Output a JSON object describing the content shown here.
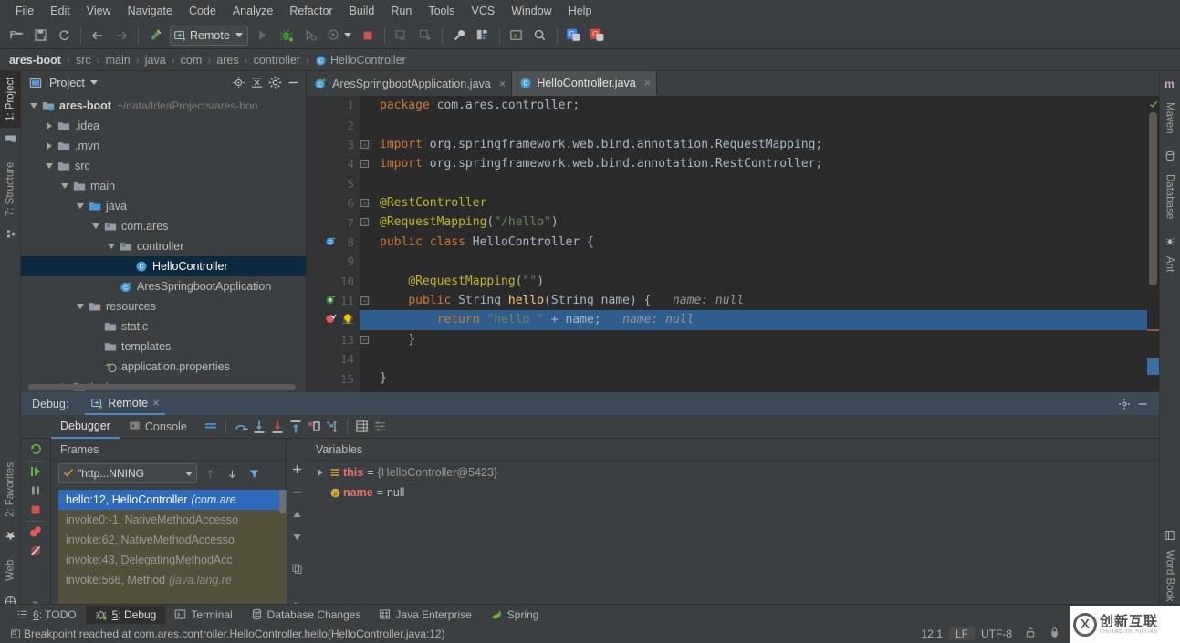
{
  "menubar": {
    "items": [
      {
        "label": "File",
        "mnemonic": "F"
      },
      {
        "label": "Edit",
        "mnemonic": "E"
      },
      {
        "label": "View",
        "mnemonic": "V"
      },
      {
        "label": "Navigate",
        "mnemonic": "N"
      },
      {
        "label": "Code",
        "mnemonic": "C"
      },
      {
        "label": "Analyze",
        "mnemonic": "A"
      },
      {
        "label": "Refactor",
        "mnemonic": "R"
      },
      {
        "label": "Build",
        "mnemonic": "B"
      },
      {
        "label": "Run",
        "mnemonic": "R"
      },
      {
        "label": "Tools",
        "mnemonic": "T"
      },
      {
        "label": "VCS",
        "mnemonic": "V"
      },
      {
        "label": "Window",
        "mnemonic": "W"
      },
      {
        "label": "Help",
        "mnemonic": "H"
      }
    ]
  },
  "toolbar": {
    "run_configuration": "Remote",
    "icons": [
      "open-folder-icon",
      "save-all-icon",
      "sync-icon",
      "back-arrow-icon",
      "forward-arrow-icon",
      "build-hammer-icon",
      "run-icon",
      "debug-icon",
      "debug-attach-icon",
      "coverage-icon",
      "stop-icon",
      "build-project-icon",
      "update-project-icon",
      "settings-wrench-icon",
      "project-structure-icon",
      "terminal-icon",
      "search-everywhere-icon",
      "translate-icon",
      "translate2-icon"
    ]
  },
  "breadcrumb": {
    "items": [
      "ares-boot",
      "src",
      "main",
      "java",
      "com",
      "ares",
      "controller",
      "HelloController"
    ],
    "separator": "›",
    "class_icon": "class-icon"
  },
  "left_stripe": {
    "items": [
      {
        "label": "1: Project",
        "mnemonic": "1",
        "selected": true
      },
      {
        "label": "7: Structure",
        "mnemonic": "7",
        "selected": false
      },
      {
        "label": "2: Favorites",
        "mnemonic": "2",
        "selected": false
      },
      {
        "label": "Web",
        "mnemonic": "",
        "selected": false
      }
    ]
  },
  "right_stripe": {
    "items": [
      {
        "label": "Maven"
      },
      {
        "label": "Database"
      },
      {
        "label": "Ant"
      },
      {
        "label": "Word Book"
      }
    ]
  },
  "project_panel": {
    "title": "Project",
    "header_icons": [
      "locate-icon",
      "collapse-all-icon",
      "gear-icon",
      "minimize-icon"
    ],
    "tree": [
      {
        "depth": 0,
        "twisty": "down",
        "icon": "module-icon",
        "label": "ares-boot",
        "sub": "~/data/IdeaProjects/ares-boo",
        "bold": true,
        "selected": false
      },
      {
        "depth": 1,
        "twisty": "right",
        "icon": "folder-icon",
        "label": ".idea",
        "sub": "",
        "bold": false,
        "selected": false
      },
      {
        "depth": 1,
        "twisty": "right",
        "icon": "folder-icon",
        "label": ".mvn",
        "sub": "",
        "bold": false,
        "selected": false
      },
      {
        "depth": 1,
        "twisty": "down",
        "icon": "folder-icon",
        "label": "src",
        "sub": "",
        "bold": false,
        "selected": false
      },
      {
        "depth": 2,
        "twisty": "down",
        "icon": "folder-icon",
        "label": "main",
        "sub": "",
        "bold": false,
        "selected": false
      },
      {
        "depth": 3,
        "twisty": "down",
        "icon": "source-folder-icon",
        "label": "java",
        "sub": "",
        "bold": false,
        "selected": false
      },
      {
        "depth": 4,
        "twisty": "down",
        "icon": "package-icon",
        "label": "com.ares",
        "sub": "",
        "bold": false,
        "selected": false
      },
      {
        "depth": 5,
        "twisty": "down",
        "icon": "package-icon",
        "label": "controller",
        "sub": "",
        "bold": false,
        "selected": false
      },
      {
        "depth": 6,
        "twisty": "none",
        "icon": "class-icon",
        "label": "HelloController",
        "sub": "",
        "bold": false,
        "selected": true
      },
      {
        "depth": 5,
        "twisty": "none",
        "icon": "spring-class-icon",
        "label": "AresSpringbootApplication",
        "sub": "",
        "bold": false,
        "selected": false
      },
      {
        "depth": 3,
        "twisty": "down",
        "icon": "resources-folder-icon",
        "label": "resources",
        "sub": "",
        "bold": false,
        "selected": false
      },
      {
        "depth": 4,
        "twisty": "none",
        "icon": "folder-icon",
        "label": "static",
        "sub": "",
        "bold": false,
        "selected": false
      },
      {
        "depth": 4,
        "twisty": "none",
        "icon": "folder-icon",
        "label": "templates",
        "sub": "",
        "bold": false,
        "selected": false
      },
      {
        "depth": 4,
        "twisty": "none",
        "icon": "properties-icon",
        "label": "application.properties",
        "sub": "",
        "bold": false,
        "selected": false
      },
      {
        "depth": 2,
        "twisty": "right",
        "icon": "folder-icon",
        "label": "test",
        "sub": "",
        "bold": false,
        "selected": false
      }
    ]
  },
  "editor": {
    "tabs": [
      {
        "label": "AresSpringbootApplication.java",
        "icon": "spring-class-icon",
        "active": false,
        "close": "×"
      },
      {
        "label": "HelloController.java",
        "icon": "class-icon",
        "active": true,
        "close": "×"
      }
    ],
    "lines": [
      {
        "n": "1",
        "tokens": [
          {
            "t": "kw",
            "v": "package"
          },
          {
            "t": "txt",
            "v": " com.ares.controller;"
          }
        ],
        "gutter": "",
        "fold": "",
        "highlight": false
      },
      {
        "n": "2",
        "tokens": [],
        "gutter": "",
        "fold": "",
        "highlight": false
      },
      {
        "n": "3",
        "tokens": [
          {
            "t": "kw",
            "v": "import"
          },
          {
            "t": "txt",
            "v": " org.springframework.web.bind.annotation.RequestMapping;"
          }
        ],
        "gutter": "",
        "fold": "minus",
        "highlight": false
      },
      {
        "n": "4",
        "tokens": [
          {
            "t": "kw",
            "v": "import"
          },
          {
            "t": "txt",
            "v": " org.springframework.web.bind.annotation.RestController;"
          }
        ],
        "gutter": "",
        "fold": "minus",
        "highlight": false
      },
      {
        "n": "5",
        "tokens": [],
        "gutter": "",
        "fold": "",
        "highlight": false
      },
      {
        "n": "6",
        "tokens": [
          {
            "t": "ann",
            "v": "@RestController"
          }
        ],
        "gutter": "",
        "fold": "minus",
        "highlight": false
      },
      {
        "n": "7",
        "tokens": [
          {
            "t": "ann",
            "v": "@RequestMapping"
          },
          {
            "t": "txt",
            "v": "("
          },
          {
            "t": "str",
            "v": "\"/hello\""
          },
          {
            "t": "txt",
            "v": ")"
          }
        ],
        "gutter": "",
        "fold": "minus",
        "highlight": false
      },
      {
        "n": "8",
        "tokens": [
          {
            "t": "kw",
            "v": "public class "
          },
          {
            "t": "txt",
            "v": "HelloController {"
          }
        ],
        "gutter": "spring-bean-icon",
        "fold": "",
        "highlight": false
      },
      {
        "n": "9",
        "tokens": [],
        "gutter": "",
        "fold": "",
        "highlight": false
      },
      {
        "n": "10",
        "tokens": [
          {
            "t": "txt",
            "v": "    "
          },
          {
            "t": "ann",
            "v": "@RequestMapping"
          },
          {
            "t": "txt",
            "v": "("
          },
          {
            "t": "str",
            "v": "\"\""
          },
          {
            "t": "txt",
            "v": ")"
          }
        ],
        "gutter": "",
        "fold": "",
        "highlight": false
      },
      {
        "n": "11",
        "tokens": [
          {
            "t": "txt",
            "v": "    "
          },
          {
            "t": "kw",
            "v": "public "
          },
          {
            "t": "txt",
            "v": "String "
          },
          {
            "t": "fn",
            "v": "hello"
          },
          {
            "t": "txt",
            "v": "(String name) {"
          },
          {
            "t": "hint",
            "v": "   name: null"
          }
        ],
        "gutter": "spring-mapping-icon",
        "fold": "minus",
        "highlight": false
      },
      {
        "n": "12",
        "tokens": [
          {
            "t": "txt",
            "v": "        "
          },
          {
            "t": "kw",
            "v": "return"
          },
          {
            "t": "str",
            "v": " \"hello \""
          },
          {
            "t": "txt",
            "v": " + name;"
          },
          {
            "t": "hint",
            "v": "   name: null"
          }
        ],
        "gutter": "breakpoint-verified-icon",
        "fold": "",
        "highlight": true
      },
      {
        "n": "13",
        "tokens": [
          {
            "t": "txt",
            "v": "    }"
          }
        ],
        "gutter": "",
        "fold": "minus",
        "highlight": false
      },
      {
        "n": "14",
        "tokens": [],
        "gutter": "",
        "fold": "",
        "highlight": false
      },
      {
        "n": "15",
        "tokens": [
          {
            "t": "txt",
            "v": "}"
          }
        ],
        "gutter": "",
        "fold": "",
        "highlight": false
      }
    ],
    "inspection_status": "ok-check-icon",
    "intention_bulb": "intention-bulb-icon"
  },
  "debug": {
    "header_label": "Debug:",
    "session_tab": "Remote",
    "session_close": "×",
    "header_icons": [
      "gear-icon",
      "minimize-icon"
    ],
    "tabs": [
      {
        "label": "Debugger",
        "icon": "",
        "active": true
      },
      {
        "label": "Console",
        "icon": "console-icon",
        "active": false
      }
    ],
    "toolbar_icons": [
      "layout-icon",
      "step-over-icon",
      "step-into-icon",
      "force-step-into-icon",
      "step-out-icon",
      "drop-frame-icon",
      "run-to-cursor-icon",
      "evaluate-icon",
      "settings-lines-icon"
    ],
    "left_actions": [
      "rerun-icon",
      "resume-icon",
      "pause-icon",
      "stop-icon",
      "mute-breakpoints-icon",
      "view-breakpoints-icon",
      "more-icon"
    ],
    "frames": {
      "title": "Frames",
      "thread_selector": "\"http...NNING",
      "thread_icons": [
        "check-icon",
        "chevron-down-icon",
        "up-arrow-icon",
        "down-arrow-icon",
        "filter-icon"
      ],
      "items": [
        {
          "label": "hello:12, HelloController",
          "pkg": "(com.are",
          "selected": true
        },
        {
          "label": "invoke0:-1, NativeMethodAccesso",
          "pkg": "",
          "selected": false
        },
        {
          "label": "invoke:62, NativeMethodAccesso",
          "pkg": "",
          "selected": false
        },
        {
          "label": "invoke:43, DelegatingMethodAcc",
          "pkg": "",
          "selected": false
        },
        {
          "label": "invoke:566, Method",
          "pkg": "(java.lang.re",
          "selected": false
        }
      ]
    },
    "variables": {
      "title": "Variables",
      "gutter_icons": [
        "plus-icon",
        "minus-icon",
        "up-icon",
        "down-icon",
        "copy-icon",
        "more-icon"
      ],
      "items": [
        {
          "expander": "right",
          "icon": "field-icon",
          "name": "this",
          "eq": "=",
          "value": "{HelloController@5423}",
          "null": false
        },
        {
          "expander": "none",
          "icon": "parameter-icon",
          "name": "name",
          "eq": "=",
          "value": "null",
          "null": true
        }
      ]
    }
  },
  "bottom_stripe": {
    "items": [
      {
        "label": "6: TODO",
        "mnemonic": "6",
        "icon": "todo-icon",
        "selected": false
      },
      {
        "label": "5: Debug",
        "mnemonic": "5",
        "icon": "debug-icon",
        "selected": true
      },
      {
        "label": "Terminal",
        "mnemonic": "",
        "icon": "terminal-icon",
        "selected": false
      },
      {
        "label": "Database Changes",
        "mnemonic": "",
        "icon": "database-changes-icon",
        "selected": false
      },
      {
        "label": "Java Enterprise",
        "mnemonic": "",
        "icon": "java-enterprise-icon",
        "selected": false
      },
      {
        "label": "Spring",
        "mnemonic": "",
        "icon": "spring-icon",
        "selected": false
      }
    ]
  },
  "status_bar": {
    "message_icon": "message-icon",
    "message": "Breakpoint reached at com.ares.controller.HelloController.hello(HelloController.java:12)",
    "caret_position": "12:1",
    "line_separator": "LF",
    "encoding": "UTF-8",
    "lock_icon": "unlock-icon",
    "inspection_icon": "inspection-hector-icon"
  },
  "watermark": {
    "cn": "创新互联",
    "en": "CHUANG XIN HU LIAN",
    "mark": "X"
  },
  "colors": {
    "panel_bg": "#3c3f41",
    "editor_bg": "#2b2b2b",
    "gutter_bg": "#313335",
    "selection_blue": "#2f5e8e",
    "tree_selection": "#0d293e",
    "frames_bg": "#53503c",
    "frame_selected": "#2f6bbd",
    "debug_header": "#3c4a57",
    "accent_underline": "#4a88c7",
    "keyword": "#cc7832",
    "string": "#6a8759",
    "annotation": "#bbb529",
    "function": "#ffc66d",
    "text": "#a9b7c6"
  }
}
